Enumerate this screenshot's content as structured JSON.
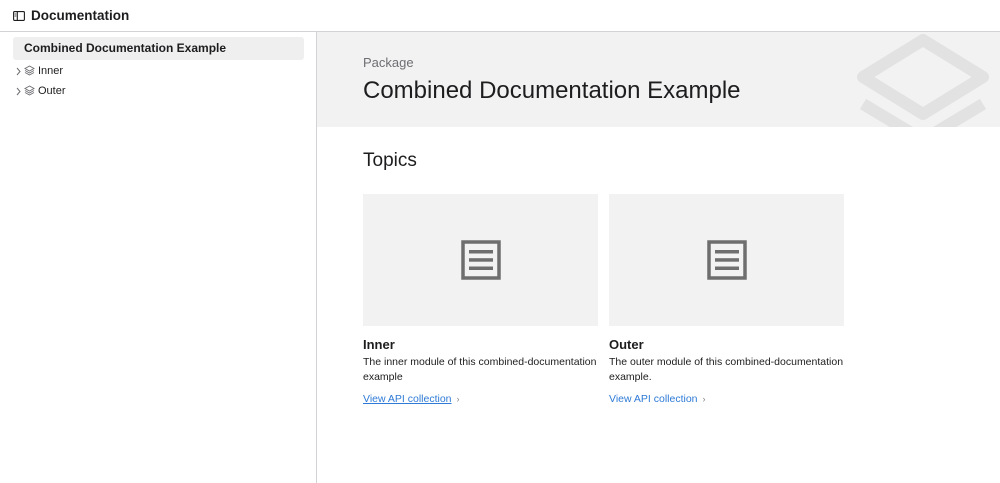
{
  "topbar": {
    "title": "Documentation",
    "toggle_icon": "sidebar-toggle-icon"
  },
  "sidebar": {
    "selected_label": "Combined Documentation Example",
    "items": [
      {
        "label": "Inner",
        "icon": "module-icon"
      },
      {
        "label": "Outer",
        "icon": "module-icon"
      }
    ]
  },
  "hero": {
    "eyebrow": "Package",
    "title": "Combined Documentation Example",
    "background": "#f2f2f2"
  },
  "topics": {
    "heading": "Topics",
    "cards": [
      {
        "title": "Inner",
        "description": "The inner module of this combined-documentation example",
        "link": "View API collection",
        "icon": "article-icon"
      },
      {
        "title": "Outer",
        "description": "The outer module of this combined-documentation example.",
        "link": "View API collection",
        "icon": "article-icon"
      }
    ]
  },
  "colors": {
    "link": "#2e7ad6",
    "border": "#d2d2d7",
    "panel": "#f2f2f2",
    "icon": "#6e6e6e"
  }
}
